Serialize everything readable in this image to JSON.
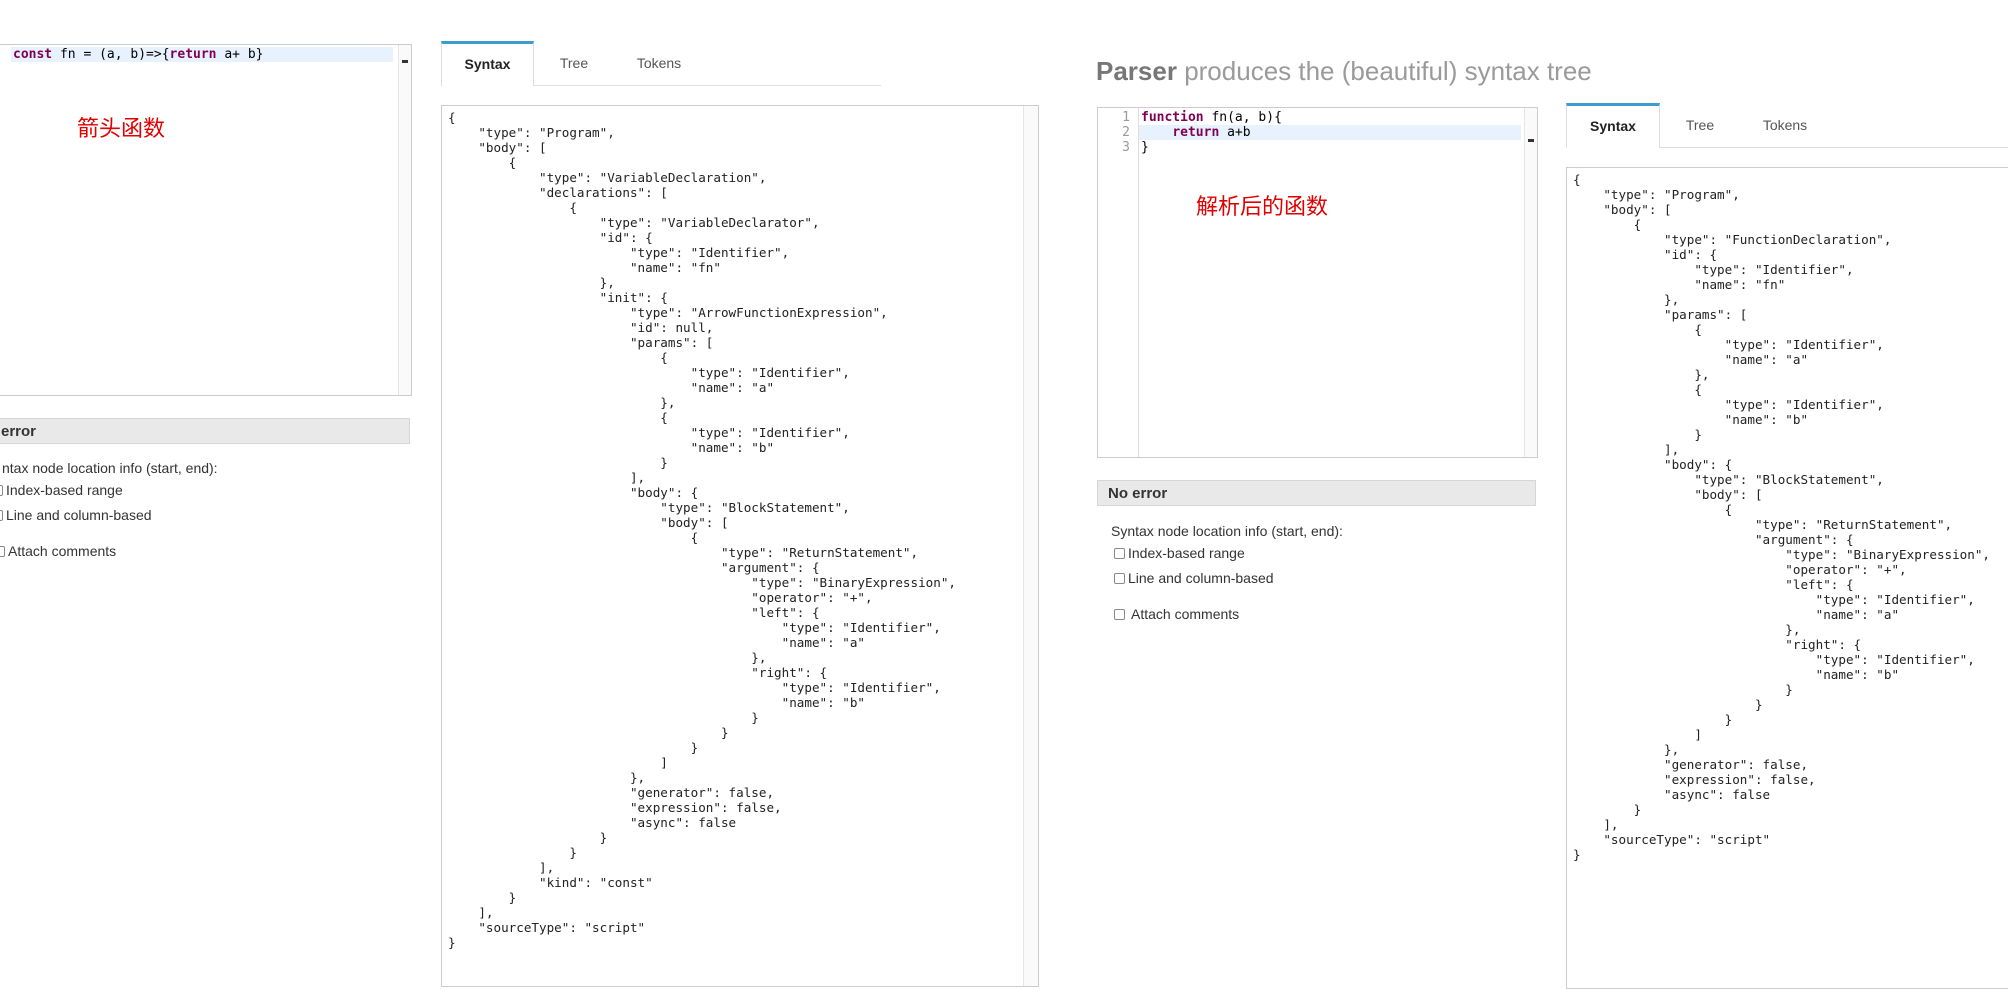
{
  "left": {
    "editor": {
      "lines": [
        {
          "kw1": "const",
          "mid": " fn = (a, b)=>{",
          "kw2": "return",
          "rest": " a+ b}"
        }
      ]
    },
    "annotation": "箭头函数",
    "status": "error",
    "options": {
      "heading": "ntax node location info (start, end):",
      "index_range": "Index-based range",
      "line_column": "Line and column-based",
      "attach_comments": "Attach comments"
    },
    "tabs": [
      "Syntax",
      "Tree",
      "Tokens"
    ],
    "syntax_output": "{\n    \"type\": \"Program\",\n    \"body\": [\n        {\n            \"type\": \"VariableDeclaration\",\n            \"declarations\": [\n                {\n                    \"type\": \"VariableDeclarator\",\n                    \"id\": {\n                        \"type\": \"Identifier\",\n                        \"name\": \"fn\"\n                    },\n                    \"init\": {\n                        \"type\": \"ArrowFunctionExpression\",\n                        \"id\": null,\n                        \"params\": [\n                            {\n                                \"type\": \"Identifier\",\n                                \"name\": \"a\"\n                            },\n                            {\n                                \"type\": \"Identifier\",\n                                \"name\": \"b\"\n                            }\n                        ],\n                        \"body\": {\n                            \"type\": \"BlockStatement\",\n                            \"body\": [\n                                {\n                                    \"type\": \"ReturnStatement\",\n                                    \"argument\": {\n                                        \"type\": \"BinaryExpression\",\n                                        \"operator\": \"+\",\n                                        \"left\": {\n                                            \"type\": \"Identifier\",\n                                            \"name\": \"a\"\n                                        },\n                                        \"right\": {\n                                            \"type\": \"Identifier\",\n                                            \"name\": \"b\"\n                                        }\n                                    }\n                                }\n                            ]\n                        },\n                        \"generator\": false,\n                        \"expression\": false,\n                        \"async\": false\n                    }\n                }\n            ],\n            \"kind\": \"const\"\n        }\n    ],\n    \"sourceType\": \"script\"\n}"
  },
  "right": {
    "heading_bold": "Parser",
    "heading_rest": " produces the (beautiful) syntax tree",
    "editor": {
      "line_numbers": [
        "1",
        "2",
        "3"
      ],
      "line1_kw": "function",
      "line1_rest": " fn(a, b){",
      "line2_indent": "    ",
      "line2_kw": "return",
      "line2_rest": " a+b",
      "line3": "}"
    },
    "annotation": "解析后的函数",
    "status": "No error",
    "options": {
      "heading": "Syntax node location info (start, end):",
      "index_range": "Index-based range",
      "line_column": "Line and column-based",
      "attach_comments": "Attach comments"
    },
    "tabs": [
      "Syntax",
      "Tree",
      "Tokens"
    ],
    "syntax_output": "{\n    \"type\": \"Program\",\n    \"body\": [\n        {\n            \"type\": \"FunctionDeclaration\",\n            \"id\": {\n                \"type\": \"Identifier\",\n                \"name\": \"fn\"\n            },\n            \"params\": [\n                {\n                    \"type\": \"Identifier\",\n                    \"name\": \"a\"\n                },\n                {\n                    \"type\": \"Identifier\",\n                    \"name\": \"b\"\n                }\n            ],\n            \"body\": {\n                \"type\": \"BlockStatement\",\n                \"body\": [\n                    {\n                        \"type\": \"ReturnStatement\",\n                        \"argument\": {\n                            \"type\": \"BinaryExpression\",\n                            \"operator\": \"+\",\n                            \"left\": {\n                                \"type\": \"Identifier\",\n                                \"name\": \"a\"\n                            },\n                            \"right\": {\n                                \"type\": \"Identifier\",\n                                \"name\": \"b\"\n                            }\n                        }\n                    }\n                ]\n            },\n            \"generator\": false,\n            \"expression\": false,\n            \"async\": false\n        }\n    ],\n    \"sourceType\": \"script\"\n}"
  },
  "colors": {
    "keyword": "#7f0055",
    "annotation": "#e00000",
    "tab_accent": "#3d9ccf",
    "active_line": "#e8f2ff"
  }
}
